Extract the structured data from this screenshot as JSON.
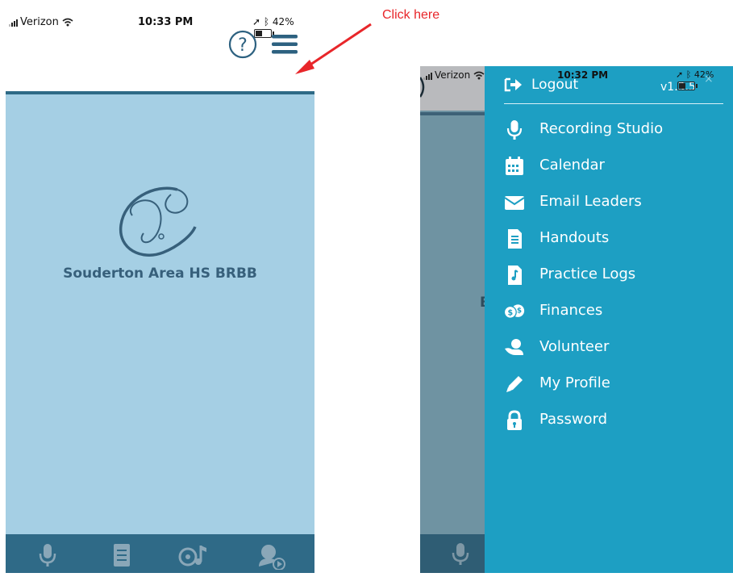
{
  "annotation": {
    "text": "Click here"
  },
  "left_phone": {
    "status": {
      "carrier": "Verizon",
      "time": "10:33 PM",
      "battery": "42%",
      "battery_level": 0.42
    },
    "org_name": "Souderton Area HS BRBB",
    "tabs": [
      "microphone-icon",
      "checklist-icon",
      "music-note-icon",
      "headset-play-icon"
    ]
  },
  "right_phone": {
    "status": {
      "carrier": "Verizon",
      "time": "10:32 PM",
      "battery": "42%",
      "battery_level": 0.42
    },
    "behind_text": "B",
    "drawer": {
      "logout_label": "Logout",
      "version": "v1.3.5",
      "close_glyph": "×",
      "items": [
        {
          "label": "Recording Studio",
          "icon": "microphone-icon"
        },
        {
          "label": "Calendar",
          "icon": "calendar-icon"
        },
        {
          "label": "Email Leaders",
          "icon": "envelope-icon"
        },
        {
          "label": "Handouts",
          "icon": "document-icon"
        },
        {
          "label": "Practice Logs",
          "icon": "music-note-icon"
        },
        {
          "label": "Finances",
          "icon": "coins-icon"
        },
        {
          "label": "Volunteer",
          "icon": "hand-user-icon"
        },
        {
          "label": "My Profile",
          "icon": "pencil-icon"
        },
        {
          "label": "Password",
          "icon": "lock-icon"
        }
      ]
    }
  },
  "colors": {
    "annotation": "#e8262a",
    "main_background": "#a5cfe4",
    "nav_dark": "#2f6a87",
    "drawer": "#1d9fc3"
  }
}
